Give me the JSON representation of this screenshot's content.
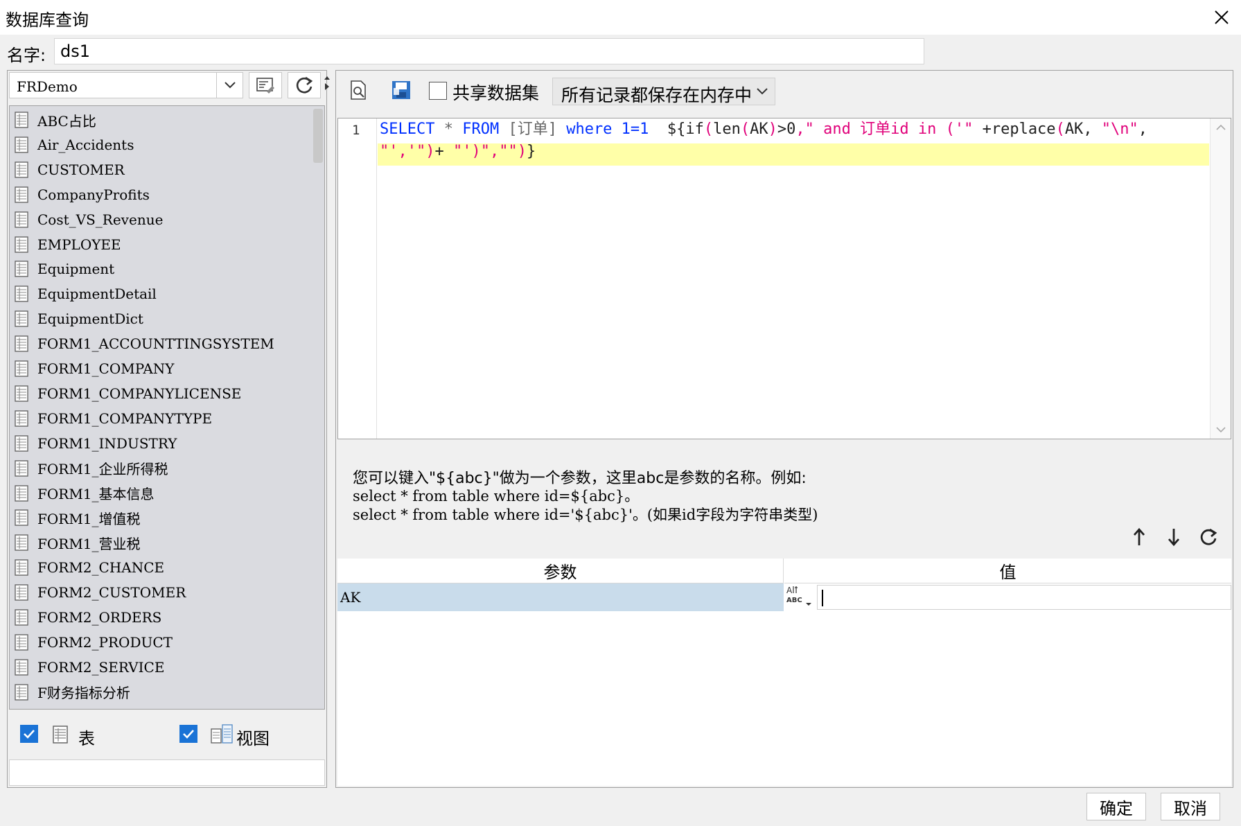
{
  "window": {
    "title": "数据库查询"
  },
  "name_field": {
    "label": "名字:",
    "value": "ds1"
  },
  "datasource": {
    "selected": "FRDemo"
  },
  "tables": [
    "ABC占比",
    "Air_Accidents",
    "CUSTOMER",
    "CompanyProfits",
    "Cost_VS_Revenue",
    "EMPLOYEE",
    "Equipment",
    "EquipmentDetail",
    "EquipmentDict",
    "FORM1_ACCOUNTTINGSYSTEM",
    "FORM1_COMPANY",
    "FORM1_COMPANYLICENSE",
    "FORM1_COMPANYTYPE",
    "FORM1_INDUSTRY",
    "FORM1_企业所得税",
    "FORM1_基本信息",
    "FORM1_增值税",
    "FORM1_营业税",
    "FORM2_CHANCE",
    "FORM2_CUSTOMER",
    "FORM2_ORDERS",
    "FORM2_PRODUCT",
    "FORM2_SERVICE",
    "F财务指标分析"
  ],
  "filters": {
    "table_label": "表",
    "view_label": "视图"
  },
  "toolbar": {
    "share_label": "共享数据集",
    "memory_option": "所有记录都保存在内存中"
  },
  "editor": {
    "line_number": "1",
    "line1_parts": [
      {
        "t": "SELECT",
        "c": "kw"
      },
      {
        "t": " * ",
        "c": "gray"
      },
      {
        "t": "FROM",
        "c": "kw"
      },
      {
        "t": " [订单] ",
        "c": "gray"
      },
      {
        "t": "where",
        "c": "kw"
      },
      {
        "t": " 1=1  ",
        "c": "kw"
      },
      {
        "t": "${if",
        "c": "plain"
      },
      {
        "t": "(",
        "c": "str"
      },
      {
        "t": "len",
        "c": "plain"
      },
      {
        "t": "(",
        "c": "str"
      },
      {
        "t": "AK",
        "c": "plain"
      },
      {
        "t": ")",
        "c": "str"
      },
      {
        "t": ">0",
        "c": "plain"
      },
      {
        "t": ",\" and 订单id in ('\"",
        "c": "str"
      },
      {
        "t": " +replace",
        "c": "plain"
      },
      {
        "t": "(",
        "c": "str"
      },
      {
        "t": "AK, ",
        "c": "plain"
      },
      {
        "t": "\"\\n\"",
        "c": "str"
      },
      {
        "t": ",",
        "c": "plain"
      }
    ],
    "line2_parts": [
      {
        "t": "\"','\")",
        "c": "str"
      },
      {
        "t": "+ ",
        "c": "plain"
      },
      {
        "t": "\"')\",\"\")",
        "c": "str"
      },
      {
        "t": "}",
        "c": "plain"
      }
    ]
  },
  "hint": {
    "line1": "您可以键入\"${abc}\"做为一个参数，这里abc是参数的名称。例如:",
    "line2": "select * from table where id=${abc}。",
    "line3": "select * from table where id='${abc}'。(如果id字段为字符串类型)"
  },
  "params": {
    "col_param": "参数",
    "col_value": "值",
    "rows": [
      {
        "name": "AK",
        "type_icon": "ABC",
        "value": ""
      }
    ]
  },
  "buttons": {
    "ok": "确定",
    "cancel": "取消"
  }
}
